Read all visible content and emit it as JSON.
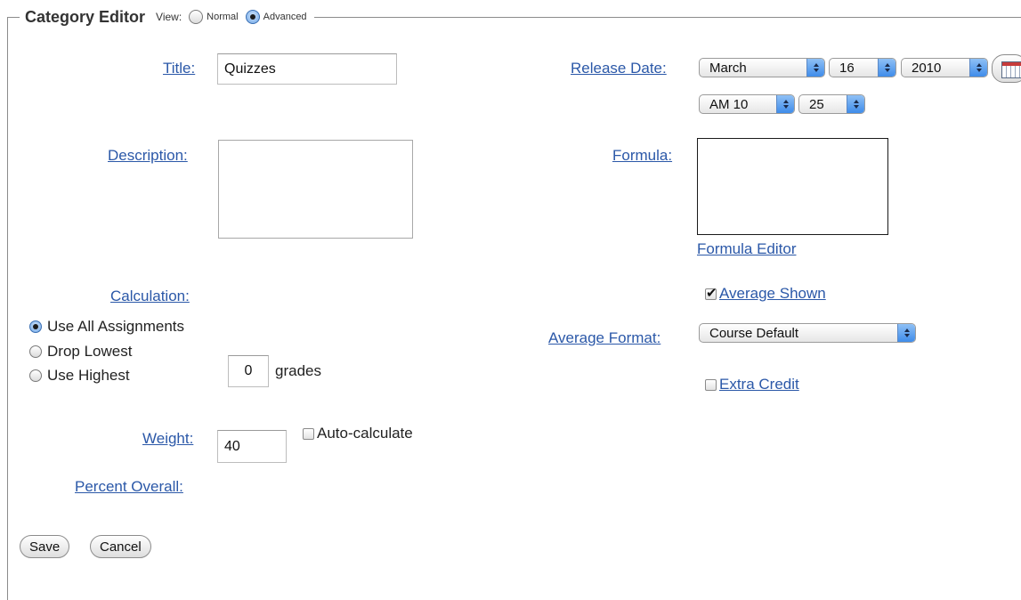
{
  "header": {
    "title": "Category Editor",
    "view_label": "View:",
    "view_options": [
      {
        "label": "Normal",
        "selected": false
      },
      {
        "label": "Advanced",
        "selected": true
      }
    ]
  },
  "form": {
    "title_label": "Title:",
    "title_value": "Quizzes",
    "description_label": "Description:",
    "description_value": "",
    "calculation_label": "Calculation:",
    "calc_options": [
      {
        "label": "Use All Assignments",
        "selected": true
      },
      {
        "label": "Drop Lowest",
        "selected": false
      },
      {
        "label": "Use Highest",
        "selected": false
      }
    ],
    "grades_value": "0",
    "grades_label": "grades",
    "weight_label": "Weight:",
    "weight_value": "40",
    "auto_calculate_label": "Auto-calculate",
    "auto_calculate_checked": false,
    "percent_overall_label": "Percent Overall:",
    "release_date_label": "Release Date:",
    "release_month": "March",
    "release_day": "16",
    "release_year": "2010",
    "release_hour": "AM 10",
    "release_minute": "25",
    "formula_label": "Formula:",
    "formula_value": "",
    "formula_editor_label": "Formula Editor",
    "average_shown_label": "Average Shown",
    "average_shown_checked": true,
    "average_format_label": "Average Format:",
    "average_format_value": "Course Default",
    "extra_credit_label": "Extra Credit",
    "extra_credit_checked": false
  },
  "buttons": {
    "save": "Save",
    "cancel": "Cancel"
  },
  "icons": {
    "calendar": "calendar-icon"
  }
}
